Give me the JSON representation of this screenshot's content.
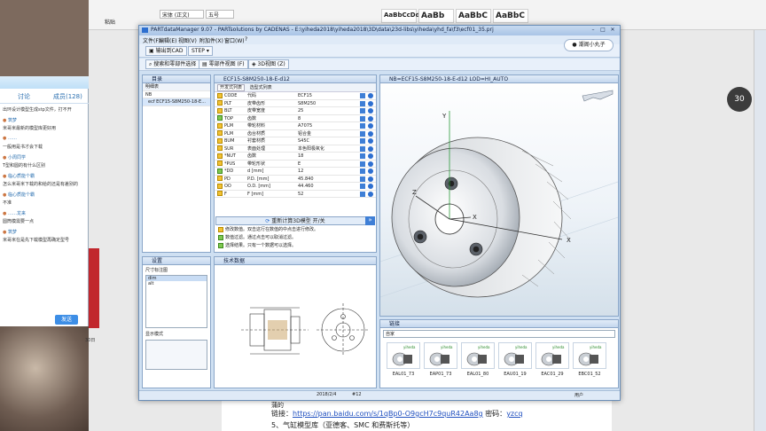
{
  "word": {
    "font_name": "宋体 (正文)",
    "font_size": "五号",
    "paste_label": "粘贴",
    "styles": [
      "AaBbCcDd",
      "AaBb",
      "AaBbC",
      "AaBbC"
    ],
    "body_fragment": "蒲的",
    "link_label": "链接：",
    "link_url": "https://pan.baidu.com/s/1qBp0-O9gcH7c9quR42Aa8g",
    "password_label": "密码：",
    "password": "yzcq",
    "next_item": "5、气缸模型库（亚德客、SMC 和费斯托等）"
  },
  "chat": {
    "tabs": [
      "讨论",
      "成员(128)"
    ],
    "messages": [
      {
        "name": "",
        "text": "出环设计模型生成stp文件，打不开"
      },
      {
        "name": "筑梦",
        "text": ""
      },
      {
        "name": "",
        "text": "米哥米最新的模型库更好用"
      },
      {
        "name": "……",
        "text": ""
      },
      {
        "name": "",
        "text": "一般用是书才会下载"
      },
      {
        "name": "小周同学",
        "text": ""
      },
      {
        "name": "",
        "text": "T型和圆的有什么区别"
      },
      {
        "name": "临心质能个霸",
        "text": ""
      },
      {
        "name": "",
        "text": "怎么米哥米下载的和给的还是有差别的"
      },
      {
        "name": "临心质能个霸",
        "text": ""
      },
      {
        "name": "",
        "text": "不准"
      },
      {
        "name": "……龙来",
        "text": ""
      },
      {
        "name": "",
        "text": "圆筒模需要一点"
      },
      {
        "name": "筑梦",
        "text": ""
      },
      {
        "name": "",
        "text": "米哥米在是先下载模型再确定型号"
      }
    ],
    "send_label": "发送",
    "float_badge": "30",
    "side_text": "30日"
  },
  "app": {
    "title": "PARTdataManager 9.07 - PARTsolutions by CADENAS - E:\\yiheda2018\\yiheda2018\\3D\\data\\23d-libs\\yiheda\\yhd_fa\\f3\\ecf01_35.prj",
    "menu": [
      "文件(F)",
      "编辑(E)",
      "视图(V)",
      "附加件(X)",
      "窗口(W)",
      "?"
    ],
    "toolbar1": [
      "输出到CAD",
      "STEP"
    ],
    "toolbar2": [
      "搜索和零部件选择",
      "零部件视图 (F)",
      "3D视图 (Z)"
    ],
    "user": "潮阁小丸子",
    "status_date": "2018/2/4",
    "status_num": "#12",
    "status_user": "用户"
  },
  "index": {
    "title": "目录",
    "header": "明细表",
    "rows": [
      "NB",
      "ecf ECF15-S8M250-18-E..."
    ]
  },
  "table": {
    "title": "ECF15-S8M250-18-E-d12",
    "tabs": [
      "开发式列表",
      "选型式列表"
    ],
    "rows": [
      {
        "code": "CODE",
        "name": "代码",
        "value": "ECF15",
        "chk": false
      },
      {
        "code": "PLT",
        "name": "皮带齿形",
        "value": "S8M250",
        "chk": false
      },
      {
        "code": "BLT",
        "name": "皮带宽度",
        "value": "25",
        "chk": false
      },
      {
        "code": "TOP",
        "name": "齿数",
        "value": "8",
        "chk": true
      },
      {
        "code": "PLM",
        "name": "带轮材料",
        "value": "A7075",
        "chk": false
      },
      {
        "code": "PLM",
        "name": "齿台材质",
        "value": "铝合金",
        "chk": false
      },
      {
        "code": "BUM",
        "name": "衬套材质",
        "value": "S45C",
        "chk": false
      },
      {
        "code": "SUR",
        "name": "表面处理",
        "value": "本色阳极氧化",
        "chk": false
      },
      {
        "code": "*NUT",
        "name": "齿数",
        "value": "18",
        "chk": false
      },
      {
        "code": "*PUS",
        "name": "带轮形状",
        "value": "E",
        "chk": false
      },
      {
        "code": "*DD",
        "name": "d [mm]",
        "value": "12",
        "chk": true
      },
      {
        "code": "PD",
        "name": "P.D. [mm]",
        "value": "45.840",
        "chk": false
      },
      {
        "code": "OO",
        "name": "O.D. [mm]",
        "value": "44.460",
        "chk": false
      },
      {
        "code": "F",
        "name": "F [mm]",
        "value": "52",
        "chk": false
      }
    ],
    "recalc": "重新计算3D模型 开/关",
    "notes": [
      "修改数值。双击这行在数值的中点击进行修改。",
      "数值过滤。通过点击可以取消过滤。",
      "选择结果。只有一个数据可以选择。"
    ]
  },
  "settings": {
    "title": "设置",
    "label1": "尺寸标注图",
    "items": [
      "dim",
      "alt"
    ],
    "label2": "显示模式"
  },
  "techdata": {
    "title": "技术数据"
  },
  "preview": {
    "title": "NB=ECF15-S8M250-18-E-d12 LOD=HI_AUTO",
    "axes": [
      "Y",
      "Z",
      "X",
      "X"
    ]
  },
  "links": {
    "title": "链接",
    "dropdown": "自家",
    "thumbs": [
      "EAL01_73",
      "EAP01_73",
      "EAL01_80",
      "EAU01_19",
      "EAC01_29",
      "EBC01_52"
    ],
    "brand": "yiheda"
  }
}
